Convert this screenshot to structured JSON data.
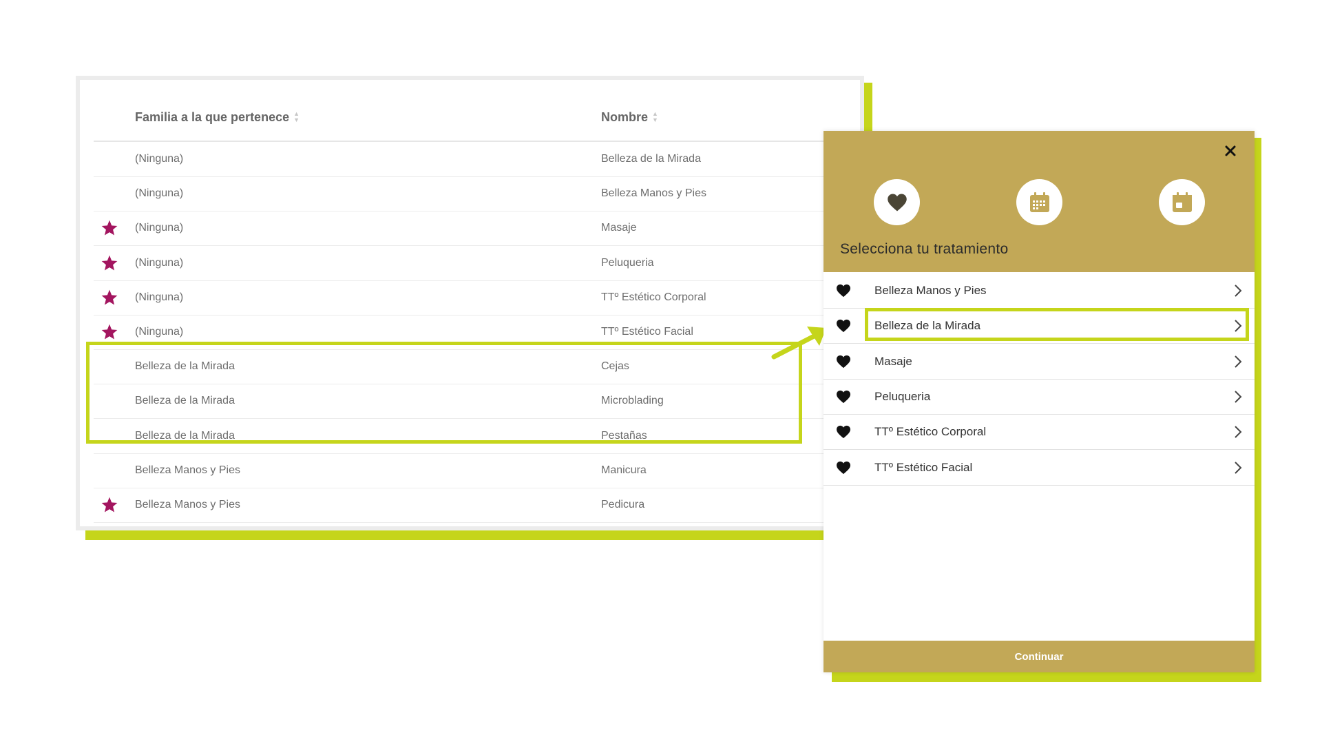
{
  "table": {
    "headers": [
      "Familia a la que pertenece",
      "Nombre"
    ],
    "rows": [
      {
        "familia": "(Ninguna)",
        "nombre": "Belleza de la Mirada",
        "starred": false
      },
      {
        "familia": "(Ninguna)",
        "nombre": "Belleza Manos y Pies",
        "starred": false
      },
      {
        "familia": "(Ninguna)",
        "nombre": "Masaje",
        "starred": true
      },
      {
        "familia": "(Ninguna)",
        "nombre": "Peluqueria",
        "starred": true
      },
      {
        "familia": "(Ninguna)",
        "nombre": "TTº Estético Corporal",
        "starred": true
      },
      {
        "familia": "(Ninguna)",
        "nombre": "TTº Estético Facial",
        "starred": true
      },
      {
        "familia": "Belleza de la Mirada",
        "nombre": "Cejas",
        "starred": false
      },
      {
        "familia": "Belleza de la Mirada",
        "nombre": "Microblading",
        "starred": false
      },
      {
        "familia": "Belleza de la Mirada",
        "nombre": "Pestañas",
        "starred": false
      },
      {
        "familia": "Belleza Manos y Pies",
        "nombre": "Manicura",
        "starred": false
      },
      {
        "familia": "Belleza Manos y Pies",
        "nombre": "Pedicura",
        "starred": true
      }
    ]
  },
  "modal": {
    "title": "Selecciona tu tratamiento",
    "steps": [
      "heart-icon",
      "calendar-grid-icon",
      "calendar-icon"
    ],
    "items": [
      {
        "label": "Belleza Manos y Pies",
        "selected": false
      },
      {
        "label": "Belleza de la Mirada",
        "selected": true
      },
      {
        "label": "Masaje",
        "selected": false
      },
      {
        "label": "Peluqueria",
        "selected": false
      },
      {
        "label": "TTº Estético Corporal",
        "selected": false
      },
      {
        "label": "TTº Estético Facial",
        "selected": false
      }
    ],
    "continue_label": "Continuar"
  },
  "colors": {
    "accent_lime": "#c5d51b",
    "gold": "#c2a857",
    "star": "#a3155f"
  }
}
